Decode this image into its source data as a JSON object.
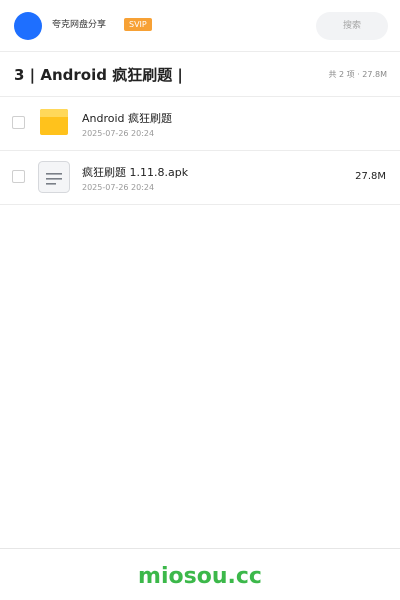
{
  "header": {
    "user_name": "夸克网盘分享",
    "vip_label": "SVIP",
    "search_placeholder": "搜索"
  },
  "folder": {
    "title": "3 | Android 疯狂刷题 |",
    "summary": "共 2 项 · 27.8M"
  },
  "files": [
    {
      "name": "Android 疯狂刷题",
      "date": "2025-07-26 20:24",
      "size": "",
      "icon": "folder-icon"
    },
    {
      "name": "疯狂刷题 1.11.8.apk",
      "date": "2025-07-26 20:24",
      "size": "27.8M",
      "icon": "apk-file-icon"
    }
  ],
  "footer": {
    "brand": "miosou.cc"
  },
  "colors": {
    "avatar": "#1e6fff",
    "vip_badge": "#f7a135",
    "folder_icon": "#ffc21c",
    "brand": "#3cb84a"
  }
}
